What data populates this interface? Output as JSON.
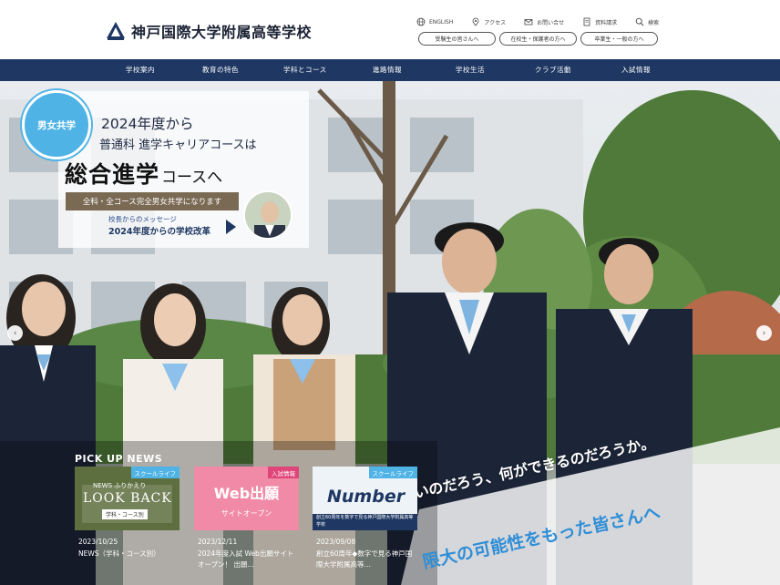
{
  "header": {
    "school_name": "神戸国際大学附属高等学校",
    "utility_links": [
      {
        "label": "ENGLISH",
        "icon": "globe-icon"
      },
      {
        "label": "アクセス",
        "icon": "location-pin-icon"
      },
      {
        "label": "お問い合せ",
        "icon": "mail-icon"
      },
      {
        "label": "資料請求",
        "icon": "document-icon"
      },
      {
        "label": "検索",
        "icon": "search-icon"
      }
    ],
    "audience_buttons": [
      "受験生の皆さんへ",
      "在校生・保護者の方へ",
      "卒業生・一般の方へ"
    ]
  },
  "nav": {
    "items": [
      "学校案内",
      "教育の特色",
      "学科とコース",
      "進路情報",
      "学校生活",
      "クラブ活動",
      "入試情報"
    ]
  },
  "hero": {
    "badge": "男女共学",
    "promo_line1": "2024年度から",
    "promo_line2": "普通科 進学キャリアコースは",
    "promo_big": "総合進学",
    "promo_big_suffix": "コースへ",
    "promo_bar": "全科・全コース完全男女共学になります",
    "message_caption": "校長からのメッセージ",
    "message_title": "2024年度からの学校改革",
    "slogan_line1": "いのだろう、何ができるのだろうか。",
    "slogan_line2": "限大の可能性をもった皆さんへ",
    "prev_icon": "chevron-left-icon",
    "next_icon": "chevron-right-icon"
  },
  "pickup": {
    "title": "PICK UP NEWS",
    "cards": [
      {
        "tag": "スクールライフ",
        "tag_color": "#4fb3e6",
        "thumb_caption": "NEWS ふりかえり",
        "thumb_big": "LOOK BACK",
        "thumb_sub": "学科・コース別",
        "date": "2023/10/25",
        "title": "NEWS（学科・コース別）"
      },
      {
        "tag": "入試情報",
        "tag_color": "#e0457a",
        "thumb_big": "Web出願",
        "thumb_sub": "サイトオープン",
        "date": "2023/12/11",
        "title": "2024年度入試 Web出願サイトオープン！ 出願…"
      },
      {
        "tag": "スクールライフ",
        "tag_color": "#4fb3e6",
        "thumb_big": "Number",
        "thumb_sub": "創立60周年を数字で見る神戸国際大学附属高等学校",
        "date": "2023/09/08",
        "title": "創立60周年◆数字で見る神戸国際大学附属高等…"
      }
    ]
  },
  "colors": {
    "nav_bg": "#1f3863",
    "accent_blue": "#4fb3e6",
    "entrance_pink": "#e0457a"
  }
}
